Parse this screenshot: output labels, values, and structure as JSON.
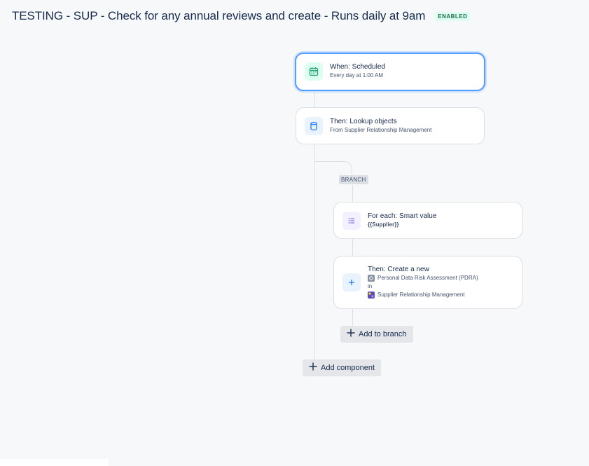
{
  "header": {
    "title": "TESTING - SUP - Check for any annual reviews and create - Runs daily at 9am",
    "status": "ENABLED"
  },
  "components": {
    "trigger": {
      "title": "When: Scheduled",
      "subtitle": "Every day at 1:00 AM",
      "icon": "calendar-icon"
    },
    "lookup": {
      "title": "Then: Lookup objects",
      "subtitle": "From Supplier Relationship Management",
      "icon": "database-icon"
    },
    "branch": {
      "label": "BRANCH"
    },
    "for_each": {
      "title": "For each: Smart value",
      "subtitle": "{{Supplier}}",
      "icon": "list-icon"
    },
    "create": {
      "title": "Then: Create a new",
      "object_type": "Personal Data Risk Assessment (PDRA)",
      "in_label": "in",
      "schema": "Supplier Relationship Management",
      "icon": "plus-icon"
    }
  },
  "actions": {
    "add_to_branch": "Add to branch",
    "add_component": "Add component"
  },
  "colors": {
    "accent": "#579dff",
    "enabled_text": "#216e4e",
    "enabled_bg": "#dcfff1",
    "connector": "#dcdfe4"
  }
}
